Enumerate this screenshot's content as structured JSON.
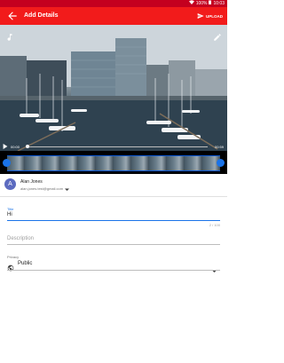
{
  "status_bar": {
    "battery": "100%",
    "time": "10:03"
  },
  "app_bar": {
    "title": "Add Details",
    "upload_label": "UPLOAD"
  },
  "player": {
    "current_time": "00:00",
    "duration": "00:59"
  },
  "account": {
    "avatar_letter": "A",
    "name": "Alan Jones",
    "email": "alan.jones.test@gmail.com"
  },
  "form": {
    "title_label": "Title",
    "title_value": "Hi",
    "title_counter": "2 / 100",
    "description_placeholder": "Description",
    "privacy_label": "Privacy",
    "privacy_value": "Public"
  },
  "colors": {
    "status_bar": "#c4001f",
    "app_bar": "#f21b1b",
    "accent": "#1a73e8"
  }
}
